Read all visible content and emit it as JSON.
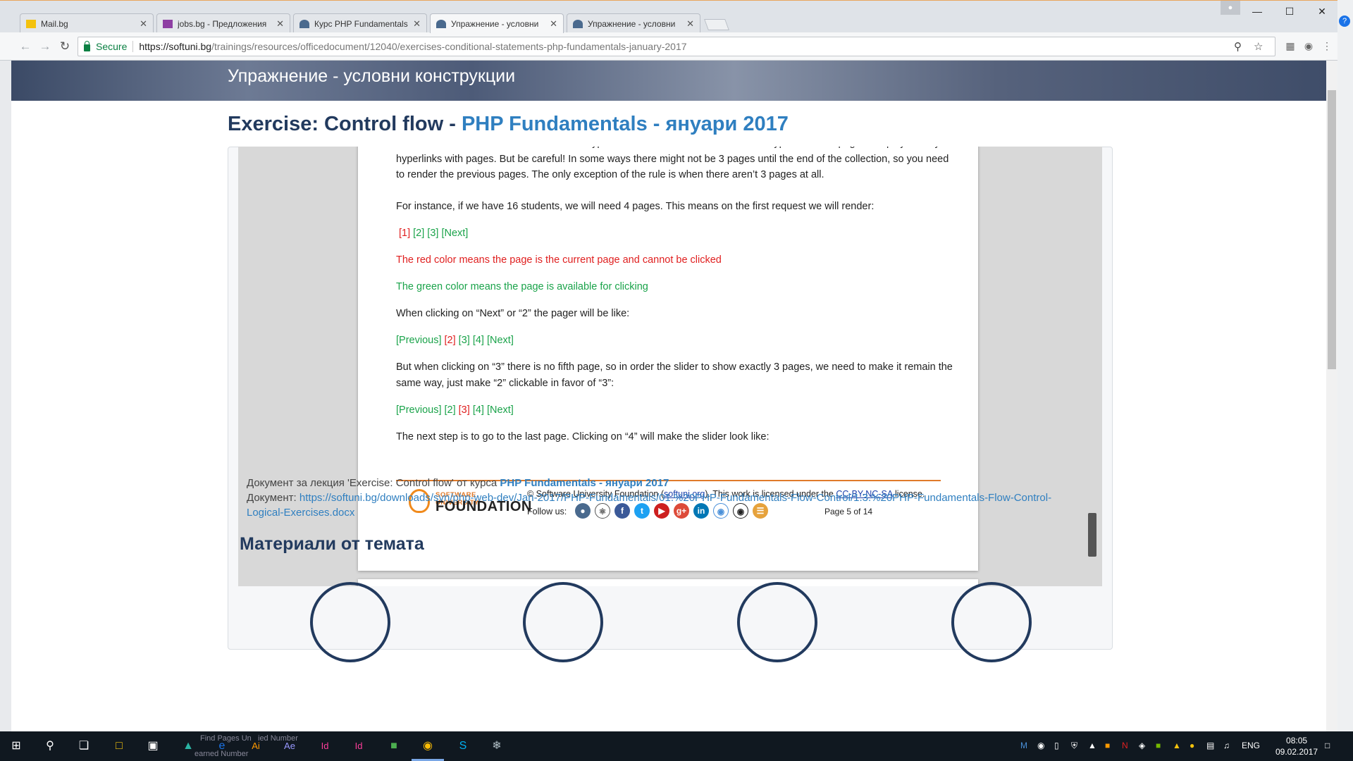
{
  "browser": {
    "tabs": [
      {
        "title": "Mail.bg",
        "favicon_color": "#f4c20d",
        "active": false
      },
      {
        "title": "jobs.bg - Предложения",
        "favicon_color": "#8e3fa3",
        "active": false
      },
      {
        "title": "Курс PHP Fundamentals",
        "favicon_color": "#4a6a8e",
        "active": false
      },
      {
        "title": "Упражнение - условни",
        "favicon_color": "#4a6a8e",
        "active": true
      },
      {
        "title": "Упражнение - условни",
        "favicon_color": "#4a6a8e",
        "active": false
      }
    ],
    "close_glyph": "✕",
    "secure_label": "Secure",
    "url_host": "https://softuni.bg",
    "url_path": "/trainings/resources/officedocument/12040/exercises-conditional-statements-php-fundamentals-january-2017"
  },
  "page": {
    "hero_title": "Упражнение - условни конструкции",
    "exercise_prefix": "Exercise: Control flow - ",
    "course_link": "PHP Fundamentals - януари 2017",
    "doc": {
      "para1": "Decorate more the last task. Between the hyperlinks \"Previous\" and \"Next\" render hyperlinks with pages. Display exactly 3 hyperlinks with pages. But be careful! In some ways there might not be 3 pages until the end of the collection, so you need to render the previous pages. The only exception of the rule is when there aren’t 3 pages at all.",
      "para2": "For instance, if we have 16 students, we will need 4 pages. This means on the first request we will render:",
      "pager1": {
        "red": "[1]",
        "green": "[2] [3] [Next]"
      },
      "red_note": "The red color means the page is the current page and cannot be clicked",
      "green_note": "The green color means the page is available for clicking",
      "para3": "When clicking on “Next” or “2” the pager will be like:",
      "pager2": {
        "g1": "[Previous]",
        "r": "[2]",
        "g2": "[3] [4] [Next]"
      },
      "para4": "But when clicking on “3” there is no fifth page, so in order the slider to show exactly 3 pages, we need to make it remain the same way, just make “2” clickable in favor of “3”:",
      "pager3": {
        "g1": "[Previous] [2]",
        "r": "[3]",
        "g2": "[4] [Next]"
      },
      "para5": "The next step is to go to the last page. Clicking on “4” will make the slider look like:",
      "footer": {
        "logo_small": "SOFTWARE UNIVERSITY",
        "logo_big": "FOUNDATION",
        "copyright": "© Software University Foundation (",
        "site": "softuni.org",
        "license_pre": "). This work is licensed under the ",
        "license": "CC-BY-NC-SA",
        "license_post": " license.",
        "follow": "Follow us:",
        "page_number": "Page 5 of 14"
      }
    },
    "meta_line1_pre": "Документ за лекция 'Exercise: Control flow' от курса ",
    "meta_line1_course": "PHP Fundamentals - януари 2017",
    "meta_line2_label": "Документ: ",
    "meta_line2_url_a": "https://softuni.bg/downloads/svn/php-web-dev/Jan-2017/PHP-Fundamentals/01.%20PHP-Fundamentals-Flow-Control/1.3.%20PHP-Fundamentals-Flow-Control-",
    "meta_line2_url_b": "Logical-Exercises.docx",
    "materials_title": "Материали от темата"
  },
  "taskbar": {
    "lang": "ENG",
    "time": "08:05",
    "date": "09.02.2017",
    "ghost_text_1": "Find Pages Un",
    "ghost_text_2": "ied Number",
    "ghost_text_3": "earned Number"
  }
}
